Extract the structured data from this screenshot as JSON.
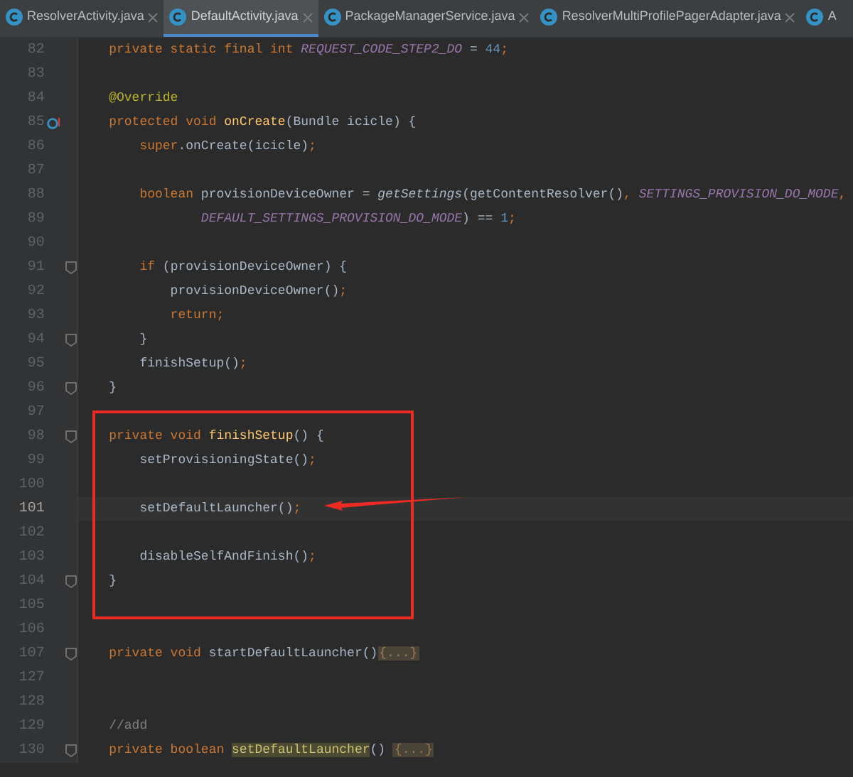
{
  "tabs": [
    {
      "label": "ResolverActivity.java",
      "selected": false,
      "closable": true
    },
    {
      "label": "DefaultActivity.java",
      "selected": true,
      "closable": true
    },
    {
      "label": "PackageManagerService.java",
      "selected": false,
      "closable": true
    },
    {
      "label": "ResolverMultiProfilePagerAdapter.java",
      "selected": false,
      "closable": true
    },
    {
      "label": "A",
      "selected": false,
      "closable": false
    }
  ],
  "lines": [
    {
      "number": "82",
      "current": false,
      "fold": false,
      "override": false,
      "tokens": [
        {
          "kind": "kw",
          "text": "    private static final int "
        },
        {
          "kind": "const",
          "text": "REQUEST_CODE_STEP2_DO"
        },
        {
          "kind": "id",
          "text": " = "
        },
        {
          "kind": "num",
          "text": "44"
        },
        {
          "kind": "kw",
          "text": ";"
        }
      ]
    },
    {
      "number": "83",
      "current": false,
      "fold": false,
      "override": false
    },
    {
      "number": "84",
      "current": false,
      "fold": false,
      "override": false,
      "tokens": [
        {
          "kind": "ann",
          "text": "    @Override"
        }
      ]
    },
    {
      "number": "85",
      "current": false,
      "fold": false,
      "override": true,
      "tokens": [
        {
          "kind": "kw",
          "text": "    protected void "
        },
        {
          "kind": "fn",
          "text": "onCreate"
        },
        {
          "kind": "id",
          "text": "(Bundle icicle) {"
        }
      ]
    },
    {
      "number": "86",
      "current": false,
      "fold": false,
      "override": false,
      "tokens": [
        {
          "kind": "kw",
          "text": "        super"
        },
        {
          "kind": "id",
          "text": ".onCreate(icicle)"
        },
        {
          "kind": "kw",
          "text": ";"
        }
      ]
    },
    {
      "number": "87",
      "current": false,
      "fold": false,
      "override": false
    },
    {
      "number": "88",
      "current": false,
      "fold": false,
      "override": false,
      "tokens": [
        {
          "kind": "kw",
          "text": "        boolean "
        },
        {
          "kind": "id",
          "text": "provisionDeviceOwner = "
        },
        {
          "kind": "static",
          "text": "getSettings"
        },
        {
          "kind": "id",
          "text": "(getContentResolver()"
        },
        {
          "kind": "kw",
          "text": ", "
        },
        {
          "kind": "const",
          "text": "SETTINGS_PROVISION_DO_MODE"
        },
        {
          "kind": "kw",
          "text": ","
        }
      ]
    },
    {
      "number": "89",
      "current": false,
      "fold": false,
      "override": false,
      "tokens": [
        {
          "kind": "const",
          "text": "                DEFAULT_SETTINGS_PROVISION_DO_MODE"
        },
        {
          "kind": "id",
          "text": ") == "
        },
        {
          "kind": "num",
          "text": "1"
        },
        {
          "kind": "kw",
          "text": ";"
        }
      ]
    },
    {
      "number": "90",
      "current": false,
      "fold": false,
      "override": false
    },
    {
      "number": "91",
      "current": false,
      "fold": true,
      "override": false,
      "tokens": [
        {
          "kind": "kw",
          "text": "        if "
        },
        {
          "kind": "id",
          "text": "(provisionDeviceOwner) {"
        }
      ]
    },
    {
      "number": "92",
      "current": false,
      "fold": false,
      "override": false,
      "tokens": [
        {
          "kind": "id",
          "text": "            provisionDeviceOwner()"
        },
        {
          "kind": "kw",
          "text": ";"
        }
      ]
    },
    {
      "number": "93",
      "current": false,
      "fold": false,
      "override": false,
      "tokens": [
        {
          "kind": "kw",
          "text": "            return;"
        }
      ]
    },
    {
      "number": "94",
      "current": false,
      "fold": true,
      "override": false,
      "tokens": [
        {
          "kind": "id",
          "text": "        }"
        }
      ]
    },
    {
      "number": "95",
      "current": false,
      "fold": false,
      "override": false,
      "tokens": [
        {
          "kind": "id",
          "text": "        finishSetup()"
        },
        {
          "kind": "kw",
          "text": ";"
        }
      ]
    },
    {
      "number": "96",
      "current": false,
      "fold": true,
      "override": false,
      "tokens": [
        {
          "kind": "id",
          "text": "    }"
        }
      ]
    },
    {
      "number": "97",
      "current": false,
      "fold": false,
      "override": false
    },
    {
      "number": "98",
      "current": false,
      "fold": true,
      "override": false,
      "tokens": [
        {
          "kind": "kw",
          "text": "    private void "
        },
        {
          "kind": "fn",
          "text": "finishSetup"
        },
        {
          "kind": "id",
          "text": "() {"
        }
      ]
    },
    {
      "number": "99",
      "current": false,
      "fold": false,
      "override": false,
      "tokens": [
        {
          "kind": "id",
          "text": "        setProvisioningState()"
        },
        {
          "kind": "kw",
          "text": ";"
        }
      ]
    },
    {
      "number": "100",
      "current": false,
      "fold": false,
      "override": false
    },
    {
      "number": "101",
      "current": true,
      "fold": false,
      "override": false,
      "tokens": [
        {
          "kind": "id",
          "text": "        setDefaultLauncher()"
        },
        {
          "kind": "kw",
          "text": ";"
        }
      ]
    },
    {
      "number": "102",
      "current": false,
      "fold": false,
      "override": false
    },
    {
      "number": "103",
      "current": false,
      "fold": false,
      "override": false,
      "tokens": [
        {
          "kind": "id",
          "text": "        disableSelfAndFinish()"
        },
        {
          "kind": "kw",
          "text": ";"
        }
      ]
    },
    {
      "number": "104",
      "current": false,
      "fold": true,
      "override": false,
      "tokens": [
        {
          "kind": "id",
          "text": "    }"
        }
      ]
    },
    {
      "number": "105",
      "current": false,
      "fold": false,
      "override": false
    },
    {
      "number": "106",
      "current": false,
      "fold": false,
      "override": false
    },
    {
      "number": "107",
      "current": false,
      "fold": true,
      "override": false,
      "tokens": [
        {
          "kind": "kw",
          "text": "    private void "
        },
        {
          "kind": "id",
          "text": "startDefaultLauncher()"
        },
        {
          "kind": "folded",
          "text": "{...}"
        }
      ]
    },
    {
      "number": "127",
      "current": false,
      "fold": false,
      "override": false
    },
    {
      "number": "128",
      "current": false,
      "fold": false,
      "override": false
    },
    {
      "number": "129",
      "current": false,
      "fold": false,
      "override": false,
      "tokens": [
        {
          "kind": "comment",
          "text": "    //add"
        }
      ]
    },
    {
      "number": "130",
      "current": false,
      "fold": true,
      "override": false,
      "tokens": [
        {
          "kind": "kw",
          "text": "    private boolean "
        },
        {
          "kind": "match",
          "text": "setDefaultLauncher"
        },
        {
          "kind": "id",
          "text": "() "
        },
        {
          "kind": "folded",
          "text": "{...}"
        }
      ]
    }
  ]
}
